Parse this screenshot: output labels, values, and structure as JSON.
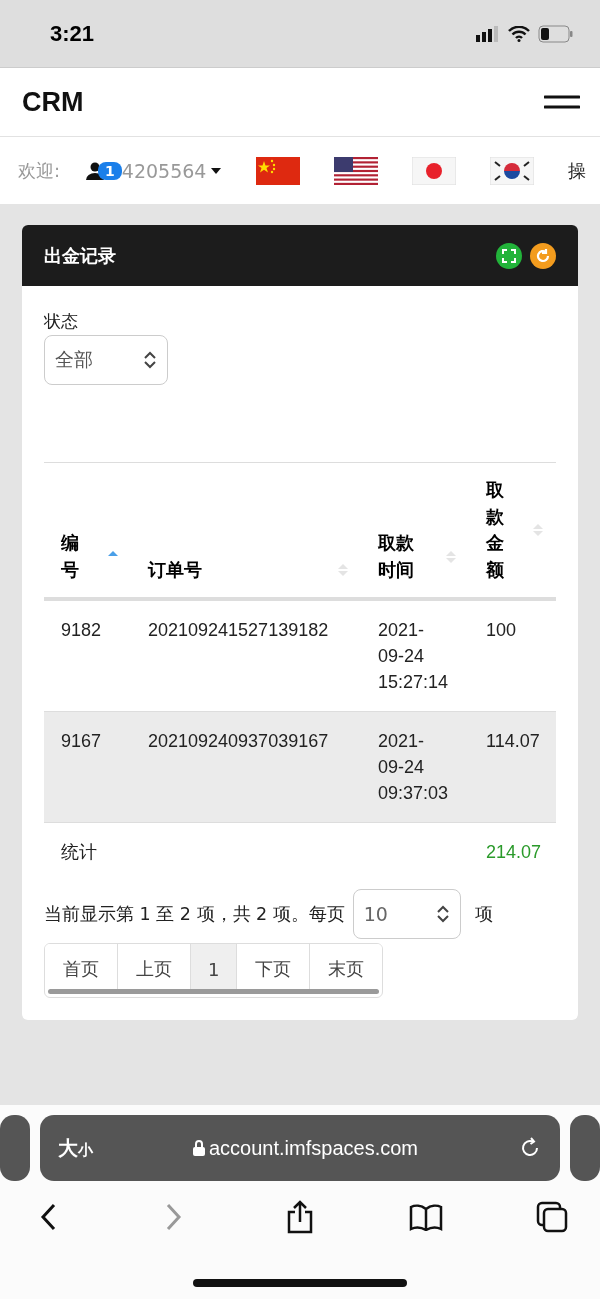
{
  "status_bar": {
    "time": "3:21"
  },
  "header": {
    "brand": "CRM"
  },
  "nav": {
    "welcome": "欢迎:",
    "badge": "1",
    "username": "4205564",
    "cut_label": "操"
  },
  "card": {
    "title": "出金记录",
    "filter": {
      "label": "状态",
      "value": "全部"
    },
    "table": {
      "columns": [
        {
          "label": "编号",
          "sorted_ascending": true
        },
        {
          "label": "订单号",
          "sorted_ascending": false
        },
        {
          "label": "取款时间",
          "sorted_ascending": false
        },
        {
          "label": "取款金额",
          "sorted_ascending": false
        }
      ],
      "rows": [
        {
          "cells": [
            "9182",
            "202109241527139182",
            "2021-09-24 15:27:14",
            "100"
          ]
        },
        {
          "cells": [
            "9167",
            "202109240937039167",
            "2021-09-24 09:37:03",
            "114.07"
          ]
        }
      ],
      "footer": {
        "label": "统计",
        "total": "214.07"
      }
    },
    "info": {
      "text": "当前显示第 1 至 2 项，共 2 项。每页",
      "page_size": "10",
      "unit": "项"
    },
    "pager": [
      {
        "label": "首页",
        "selected": false
      },
      {
        "label": "上页",
        "selected": false
      },
      {
        "label": "1",
        "selected": true
      },
      {
        "label": "下页",
        "selected": false
      },
      {
        "label": "末页",
        "selected": false
      }
    ]
  },
  "browser": {
    "text_size": [
      "大",
      "小"
    ],
    "url": "account.imfspaces.com",
    "forward_disabled": true
  }
}
